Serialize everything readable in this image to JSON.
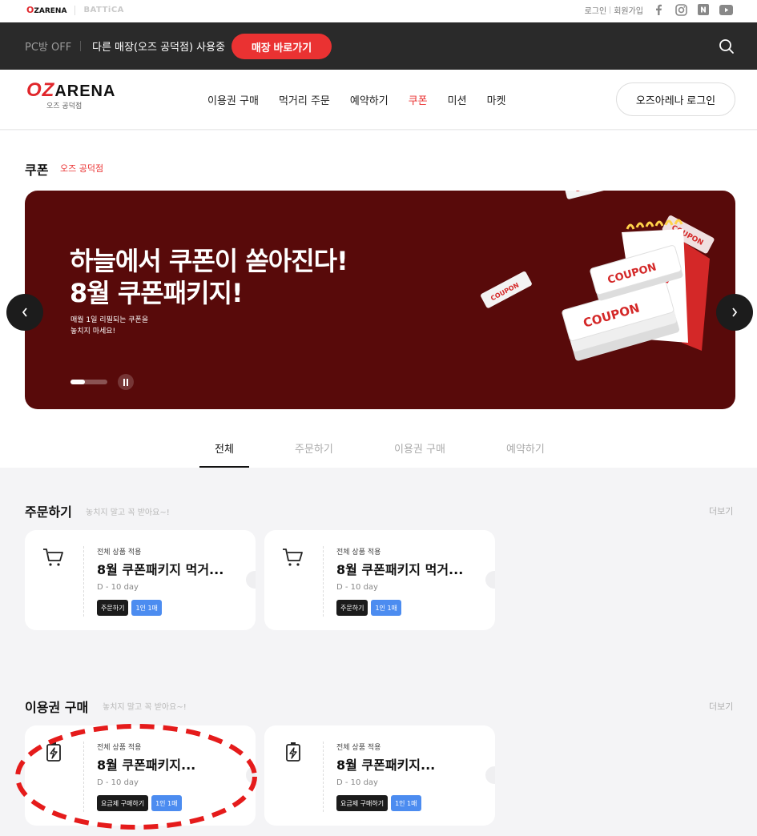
{
  "util": {
    "brand_oz": "ZARENA",
    "brand_battica": "BATTiCA",
    "login": "로그인",
    "signup": "회원가입",
    "social": [
      "facebook-icon",
      "instagram-icon",
      "naver-icon",
      "youtube-icon"
    ]
  },
  "store": {
    "pc_status": "PC방 OFF",
    "other_store": "다른 매장(오즈 공덕점) 사용중",
    "go_button": "매장 바로가기"
  },
  "header": {
    "logo_word": "ARENA",
    "logo_sub": "오즈 공덕점",
    "nav": [
      "이용권 구매",
      "먹거리 주문",
      "예약하기",
      "쿠폰",
      "미션",
      "마켓"
    ],
    "active_nav": "쿠폰",
    "login_button": "오즈아레나 로그인"
  },
  "page": {
    "title": "쿠폰",
    "store_name": "오즈 공덕점"
  },
  "banner": {
    "headline_1": "하늘에서 쿠폰이 쏟아진다!",
    "headline_2": "8월 쿠폰패키지!",
    "desc_1": "매월 1일 리필되는 쿠폰을",
    "desc_2": "놓치지 마세요!",
    "coupon_word": "COUPON",
    "progress": 0.4
  },
  "tabs": [
    "전체",
    "주문하기",
    "이용권 구매",
    "예약하기"
  ],
  "sections": [
    {
      "title": "주문하기",
      "subtitle": "놓치지 말고 꼭 받아요~!",
      "more": "더보기",
      "cards": [
        {
          "icon": "cart-icon",
          "apply": "전체 상품 적용",
          "name": "8월 쿠폰패키지 먹거...",
          "dday": "D - 10 day",
          "tag_dark": "주문하기",
          "tag_blue": "1인 1매"
        },
        {
          "icon": "cart-icon",
          "apply": "전체 상품 적용",
          "name": "8월 쿠폰패키지 먹거...",
          "dday": "D - 10 day",
          "tag_dark": "주문하기",
          "tag_blue": "1인 1매"
        }
      ]
    },
    {
      "title": "이용권 구매",
      "subtitle": "놓치지 말고 꼭 받아요~!",
      "more": "더보기",
      "cards": [
        {
          "icon": "battery-charge-icon",
          "apply": "전체 상품 적용",
          "name": "8월 쿠폰패키지...",
          "dday": "D - 10 day",
          "tag_dark": "요금제 구매하기",
          "tag_blue": "1인 1매"
        },
        {
          "icon": "battery-charge-icon",
          "apply": "전체 상품 적용",
          "name": "8월 쿠폰패키지...",
          "dday": "D - 10 day",
          "tag_dark": "요금제 구매하기",
          "tag_blue": "1인 1매"
        }
      ]
    }
  ],
  "colors": {
    "accent": "#ea3232",
    "banner_bg": "#580a0a",
    "tag_blue": "#4c8cf0",
    "annotation": "#e51b1b"
  }
}
